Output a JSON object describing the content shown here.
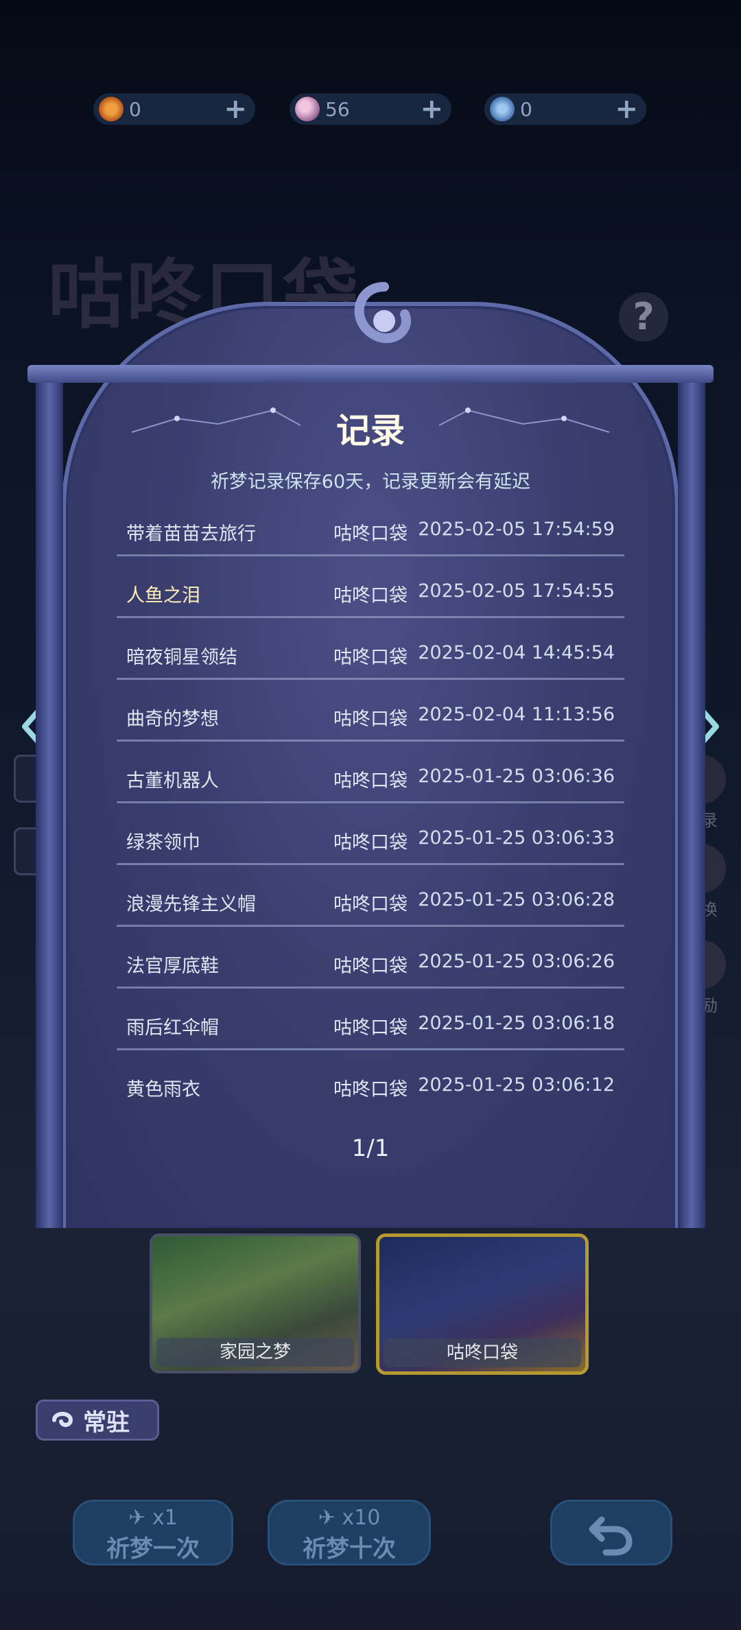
{
  "currencies": [
    {
      "value": "0",
      "icon": "sun-coin-icon",
      "color": "#e07a2a"
    },
    {
      "value": "56",
      "icon": "moon-gem-icon",
      "color": "#c77aa0"
    },
    {
      "value": "0",
      "icon": "rocket-ticket-icon",
      "color": "#4f8ad0"
    }
  ],
  "background": {
    "pool_title": "咕咚口袋",
    "help_label": "?",
    "side_labels": [
      "记录",
      "兑换",
      "奖励"
    ]
  },
  "modal": {
    "title": "记录",
    "notice": "祈梦记录保存60天，记录更新会有延迟",
    "records": [
      {
        "item": "带着苗苗去旅行",
        "pool": "咕咚口袋",
        "time": "2025-02-05 17:54:59",
        "highlight": false
      },
      {
        "item": "人鱼之泪",
        "pool": "咕咚口袋",
        "time": "2025-02-05 17:54:55",
        "highlight": true
      },
      {
        "item": "暗夜铜星领结",
        "pool": "咕咚口袋",
        "time": "2025-02-04 14:45:54",
        "highlight": false
      },
      {
        "item": "曲奇的梦想",
        "pool": "咕咚口袋",
        "time": "2025-02-04 11:13:56",
        "highlight": false
      },
      {
        "item": "古董机器人",
        "pool": "咕咚口袋",
        "time": "2025-01-25 03:06:36",
        "highlight": false
      },
      {
        "item": "绿茶领巾",
        "pool": "咕咚口袋",
        "time": "2025-01-25 03:06:33",
        "highlight": false
      },
      {
        "item": "浪漫先锋主义帽",
        "pool": "咕咚口袋",
        "time": "2025-01-25 03:06:28",
        "highlight": false
      },
      {
        "item": "法官厚底鞋",
        "pool": "咕咚口袋",
        "time": "2025-01-25 03:06:26",
        "highlight": false
      },
      {
        "item": "雨后红伞帽",
        "pool": "咕咚口袋",
        "time": "2025-01-25 03:06:18",
        "highlight": false
      },
      {
        "item": "黄色雨衣",
        "pool": "咕咚口袋",
        "time": "2025-01-25 03:06:12",
        "highlight": false
      }
    ],
    "page": "1/1"
  },
  "pools": [
    {
      "label": "家园之梦",
      "selected": false
    },
    {
      "label": "咕咚口袋",
      "selected": true
    }
  ],
  "resident_label": "常驻",
  "buttons": {
    "once": {
      "count": "x1",
      "label": "祈梦一次"
    },
    "ten": {
      "count": "x10",
      "label": "祈梦十次"
    }
  },
  "colors": {
    "accent_gold": "#fff1b8",
    "modal_bg": "#3b3f70",
    "frame": "#5e6aa8",
    "button_bg": "#1e3e62"
  }
}
